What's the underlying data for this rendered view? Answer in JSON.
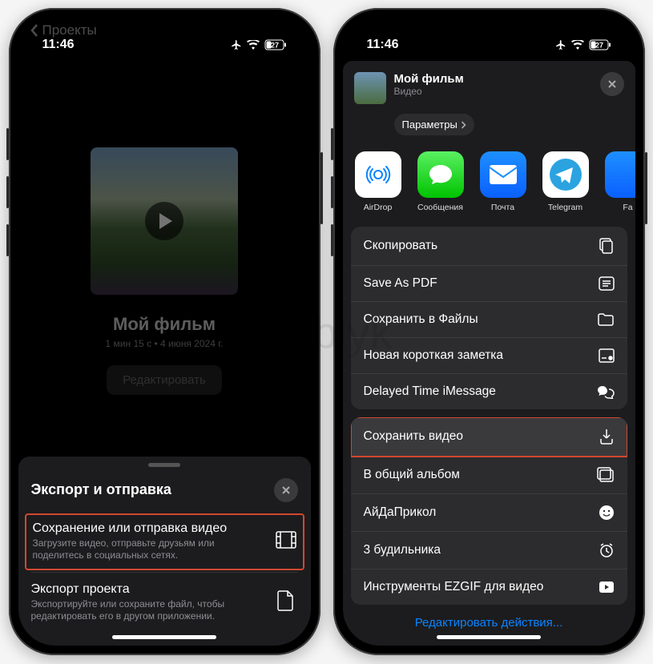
{
  "watermark": "Yablyk",
  "status": {
    "time": "11:46",
    "battery": "27"
  },
  "phone1": {
    "back_label": "Проекты",
    "movie_title": "Мой фильм",
    "movie_meta": "1 мин 15 с • 4 июня 2024 г.",
    "edit_button": "Редактировать",
    "sheet_title": "Экспорт и отправка",
    "option1_title": "Сохранение или отправка видео",
    "option1_desc": "Загрузите видео, отправьте друзьям или поделитесь в социальных сетях.",
    "option2_title": "Экспорт проекта",
    "option2_desc": "Экспортируйте или сохраните файл, чтобы редактировать его в другом приложении."
  },
  "phone2": {
    "share_name": "Мой фильм",
    "share_type": "Видео",
    "params": "Параметры",
    "apps": {
      "airdrop": "AirDrop",
      "messages": "Сообщения",
      "mail": "Почта",
      "telegram": "Telegram",
      "facetime": "Fa"
    },
    "actions": {
      "copy": "Скопировать",
      "pdf": "Save As PDF",
      "files": "Сохранить в Файлы",
      "note": "Новая короткая заметка",
      "delayed": "Delayed Time iMessage",
      "save_video": "Сохранить видео",
      "shared_album": "В общий альбом",
      "aida": "АйДаПрикол",
      "alarm": "3 будильника",
      "ezgif": "Инструменты EZGIF для видео"
    },
    "edit_actions": "Редактировать действия..."
  }
}
